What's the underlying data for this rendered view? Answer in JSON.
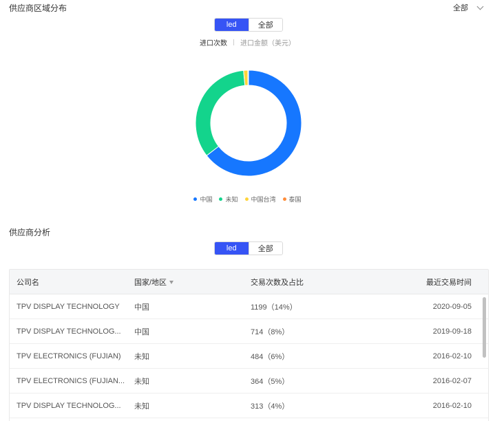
{
  "region_section": {
    "title": "供应商区域分布",
    "scope": "全部",
    "segment": {
      "active": "led",
      "inactive": "全部"
    },
    "metric_tabs": {
      "active": "进口次数",
      "inactive": "进口金额（美元）"
    }
  },
  "chart_data": {
    "type": "pie",
    "categories": [
      "中国",
      "未知",
      "中国台湾",
      "泰国"
    ],
    "values": [
      64.5,
      34.0,
      1.3,
      0.2
    ],
    "colors": [
      "#1677ff",
      "#13d48c",
      "#ffd43b",
      "#ff8c39"
    ],
    "legend_position": "bottom"
  },
  "supplier_section": {
    "title": "供应商分析",
    "segment": {
      "active": "led",
      "inactive": "全部"
    },
    "columns": [
      "公司名",
      "国家/地区",
      "交易次数及占比",
      "最近交易时间"
    ],
    "rows": [
      {
        "company": "TPV DISPLAY TECHNOLOGY",
        "region": "中国",
        "count": "1199（14%）",
        "date": "2020-09-05"
      },
      {
        "company": "TPV DISPLAY TECHNOLOG...",
        "region": "中国",
        "count": "714（8%）",
        "date": "2019-09-18"
      },
      {
        "company": "TPV ELECTRONICS (FUJIAN)",
        "region": "未知",
        "count": "484（6%）",
        "date": "2016-02-10"
      },
      {
        "company": "TPV ELECTRONICS (FUJIAN...",
        "region": "未知",
        "count": "364（5%）",
        "date": "2016-02-07"
      },
      {
        "company": "TPV DISPLAY TECHNOLOG...",
        "region": "未知",
        "count": "313（4%）",
        "date": "2016-02-10"
      }
    ]
  }
}
